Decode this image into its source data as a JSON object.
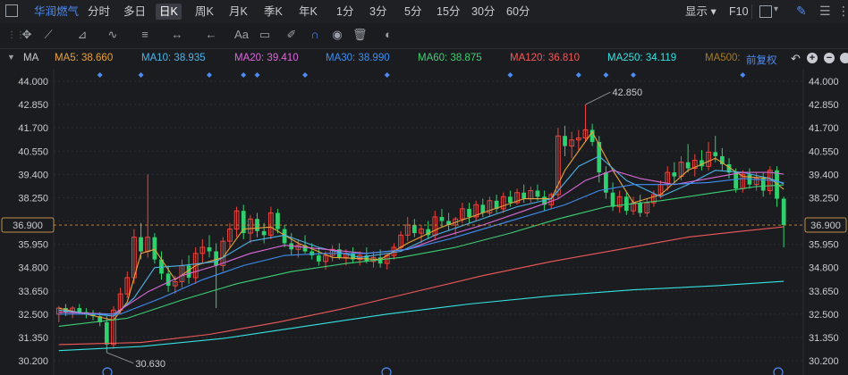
{
  "topbar": {
    "stock_name": "华润燃气",
    "tabs": [
      "分时",
      "多日",
      "日K",
      "周K",
      "月K",
      "季K",
      "年K",
      "1分",
      "3分",
      "5分",
      "15分",
      "30分",
      "60分"
    ],
    "active_tab": "日K",
    "display_label": "显示",
    "f10_label": "F10"
  },
  "ma_row": {
    "title": "MA",
    "items": [
      {
        "label": "MA5: 38.660",
        "color": "#e8a33c"
      },
      {
        "label": "MA10: 38.935",
        "color": "#4fb3e8"
      },
      {
        "label": "MA20: 39.410",
        "color": "#d86ad8"
      },
      {
        "label": "MA30: 38.990",
        "color": "#3f8ef0"
      },
      {
        "label": "MA60: 38.875",
        "color": "#3ccf73"
      },
      {
        "label": "MA120: 36.810",
        "color": "#f05a5a"
      },
      {
        "label": "MA250: 34.119",
        "color": "#35e3e3"
      },
      {
        "label": "MA500: ",
        "color": "#a07c2c"
      }
    ],
    "adjust_label": "前复权"
  },
  "chart_data": {
    "type": "candlestick",
    "y_ticks": [
      "44.000",
      "42.850",
      "41.700",
      "40.550",
      "39.400",
      "38.250",
      "37.100",
      "35.950",
      "34.800",
      "33.650",
      "32.500",
      "31.350",
      "30.200"
    ],
    "ylim": [
      30.2,
      44.0
    ],
    "current_price": "36.900",
    "annotations": {
      "high": "42.850",
      "low": "30.630"
    },
    "colors": {
      "up": "#f0443b",
      "down": "#2fd06e",
      "background": "#1b1c20",
      "grid": "#2a2c31"
    },
    "candles": [
      [
        32.5,
        32.9,
        32.1,
        32.8
      ],
      [
        32.8,
        33.0,
        32.4,
        32.6
      ],
      [
        32.6,
        32.9,
        32.3,
        32.8
      ],
      [
        32.8,
        33.0,
        32.5,
        32.6
      ],
      [
        32.6,
        32.8,
        32.3,
        32.5
      ],
      [
        32.5,
        32.7,
        32.2,
        32.4
      ],
      [
        32.4,
        32.6,
        31.9,
        32.1
      ],
      [
        32.1,
        32.4,
        30.6,
        31.0
      ],
      [
        31.0,
        32.9,
        30.8,
        32.7
      ],
      [
        32.7,
        33.8,
        32.5,
        33.5
      ],
      [
        33.5,
        34.6,
        33.3,
        34.3
      ],
      [
        34.3,
        36.7,
        34.0,
        36.3
      ],
      [
        36.3,
        37.0,
        35.2,
        35.6
      ],
      [
        35.6,
        39.4,
        35.3,
        36.3
      ],
      [
        36.3,
        36.5,
        35.0,
        35.2
      ],
      [
        35.2,
        35.6,
        34.2,
        34.5
      ],
      [
        34.5,
        34.9,
        33.6,
        33.9
      ],
      [
        33.9,
        34.4,
        33.5,
        34.1
      ],
      [
        34.1,
        35.2,
        33.8,
        34.9
      ],
      [
        34.9,
        35.4,
        34.0,
        34.3
      ],
      [
        34.3,
        35.8,
        34.0,
        35.5
      ],
      [
        35.5,
        36.2,
        35.0,
        35.8
      ],
      [
        35.8,
        36.4,
        35.3,
        35.6
      ],
      [
        35.6,
        36.0,
        32.8,
        34.9
      ],
      [
        34.9,
        36.3,
        34.6,
        36.1
      ],
      [
        36.1,
        37.0,
        35.8,
        36.7
      ],
      [
        36.7,
        37.8,
        36.3,
        37.6
      ],
      [
        37.6,
        37.9,
        36.2,
        36.5
      ],
      [
        36.5,
        37.4,
        36.0,
        37.2
      ],
      [
        37.2,
        37.5,
        36.3,
        36.6
      ],
      [
        36.6,
        37.0,
        36.0,
        36.4
      ],
      [
        36.4,
        37.8,
        36.2,
        37.5
      ],
      [
        37.5,
        37.7,
        36.5,
        36.7
      ],
      [
        36.7,
        36.9,
        35.8,
        36.0
      ],
      [
        36.0,
        36.5,
        35.4,
        35.7
      ],
      [
        35.7,
        36.2,
        35.3,
        35.9
      ],
      [
        35.9,
        36.4,
        35.5,
        35.6
      ],
      [
        35.6,
        36.0,
        35.2,
        35.4
      ],
      [
        35.4,
        35.8,
        34.9,
        35.1
      ],
      [
        35.1,
        35.6,
        34.7,
        35.4
      ],
      [
        35.4,
        35.9,
        35.1,
        35.7
      ],
      [
        35.7,
        36.0,
        35.2,
        35.3
      ],
      [
        35.3,
        35.7,
        34.9,
        35.5
      ],
      [
        35.5,
        35.8,
        35.0,
        35.2
      ],
      [
        35.2,
        35.6,
        34.9,
        35.4
      ],
      [
        35.4,
        35.8,
        35.0,
        35.1
      ],
      [
        35.1,
        35.6,
        34.8,
        35.3
      ],
      [
        35.3,
        35.7,
        34.8,
        35.0
      ],
      [
        35.0,
        35.5,
        34.7,
        35.4
      ],
      [
        35.4,
        36.0,
        35.2,
        35.8
      ],
      [
        35.8,
        36.6,
        35.6,
        36.4
      ],
      [
        36.4,
        37.3,
        36.1,
        36.9
      ],
      [
        36.9,
        37.2,
        36.3,
        36.5
      ],
      [
        36.5,
        36.9,
        36.0,
        36.7
      ],
      [
        36.7,
        37.1,
        36.2,
        36.4
      ],
      [
        36.4,
        37.6,
        36.2,
        37.3
      ],
      [
        37.3,
        37.7,
        36.8,
        37.1
      ],
      [
        37.1,
        37.5,
        36.6,
        36.9
      ],
      [
        36.9,
        37.3,
        36.4,
        37.2
      ],
      [
        37.2,
        38.0,
        37.0,
        37.7
      ],
      [
        37.7,
        38.0,
        37.0,
        37.3
      ],
      [
        37.3,
        38.1,
        37.1,
        37.9
      ],
      [
        37.9,
        38.2,
        37.3,
        37.5
      ],
      [
        37.5,
        38.3,
        37.3,
        38.1
      ],
      [
        38.1,
        38.4,
        37.5,
        37.7
      ],
      [
        37.7,
        38.5,
        37.5,
        38.3
      ],
      [
        38.3,
        38.6,
        37.8,
        38.0
      ],
      [
        38.0,
        38.7,
        37.9,
        38.5
      ],
      [
        38.5,
        38.9,
        38.0,
        38.2
      ],
      [
        38.2,
        38.8,
        38.0,
        38.6
      ],
      [
        38.6,
        38.9,
        38.1,
        38.3
      ],
      [
        38.3,
        38.6,
        37.6,
        37.9
      ],
      [
        37.9,
        38.5,
        37.7,
        38.4
      ],
      [
        38.4,
        41.7,
        38.2,
        41.3
      ],
      [
        41.3,
        41.8,
        40.3,
        40.8
      ],
      [
        40.8,
        41.5,
        40.2,
        41.1
      ],
      [
        41.1,
        41.6,
        40.6,
        41.2
      ],
      [
        41.2,
        42.85,
        41.0,
        41.6
      ],
      [
        41.6,
        41.9,
        40.8,
        41.0
      ],
      [
        41.0,
        41.3,
        39.0,
        39.5
      ],
      [
        39.5,
        39.8,
        38.2,
        38.5
      ],
      [
        38.5,
        39.0,
        37.6,
        37.8
      ],
      [
        37.8,
        38.6,
        37.5,
        38.3
      ],
      [
        38.3,
        38.5,
        37.4,
        37.6
      ],
      [
        37.6,
        38.3,
        37.4,
        38.0
      ],
      [
        38.0,
        38.4,
        37.3,
        37.5
      ],
      [
        37.5,
        38.2,
        37.3,
        38.0
      ],
      [
        38.0,
        38.6,
        37.8,
        38.4
      ],
      [
        38.4,
        39.1,
        38.2,
        38.9
      ],
      [
        38.9,
        39.8,
        38.6,
        39.5
      ],
      [
        39.5,
        40.0,
        39.0,
        39.3
      ],
      [
        39.3,
        40.3,
        39.1,
        40.0
      ],
      [
        40.0,
        40.9,
        39.5,
        39.7
      ],
      [
        39.7,
        40.4,
        39.3,
        40.1
      ],
      [
        40.1,
        40.6,
        39.6,
        39.8
      ],
      [
        39.8,
        41.0,
        39.6,
        40.5
      ],
      [
        40.5,
        41.3,
        40.0,
        40.3
      ],
      [
        40.3,
        40.7,
        39.6,
        39.9
      ],
      [
        39.9,
        40.2,
        39.2,
        39.5
      ],
      [
        39.5,
        39.7,
        38.5,
        38.7
      ],
      [
        38.7,
        39.6,
        38.5,
        39.4
      ],
      [
        39.4,
        39.7,
        38.7,
        38.9
      ],
      [
        38.9,
        39.5,
        38.6,
        39.2
      ],
      [
        39.2,
        39.5,
        38.3,
        38.6
      ],
      [
        38.6,
        39.8,
        38.4,
        39.6
      ],
      [
        39.6,
        39.8,
        37.8,
        38.2
      ],
      [
        38.2,
        38.3,
        35.8,
        36.9
      ]
    ],
    "moving_averages": {
      "MA5": [
        [
          0,
          32.8
        ],
        [
          8,
          32.2
        ],
        [
          10,
          33.1
        ],
        [
          12,
          35.5
        ],
        [
          14,
          35.7
        ],
        [
          17,
          34.2
        ],
        [
          20,
          34.9
        ],
        [
          24,
          35.3
        ],
        [
          27,
          36.7
        ],
        [
          31,
          36.8
        ],
        [
          35,
          36.0
        ],
        [
          40,
          35.3
        ],
        [
          47,
          35.2
        ],
        [
          51,
          36.0
        ],
        [
          56,
          36.8
        ],
        [
          62,
          37.5
        ],
        [
          68,
          38.2
        ],
        [
          72,
          38.2
        ],
        [
          74,
          39.6
        ],
        [
          78,
          41.5
        ],
        [
          81,
          39.6
        ],
        [
          84,
          38.0
        ],
        [
          88,
          38.4
        ],
        [
          92,
          39.6
        ],
        [
          96,
          40.2
        ],
        [
          100,
          39.3
        ],
        [
          104,
          39.2
        ],
        [
          106,
          38.66
        ]
      ],
      "MA10": [
        [
          0,
          32.7
        ],
        [
          8,
          32.4
        ],
        [
          11,
          33.3
        ],
        [
          14,
          34.8
        ],
        [
          18,
          34.9
        ],
        [
          23,
          35.1
        ],
        [
          28,
          36.1
        ],
        [
          33,
          36.4
        ],
        [
          38,
          35.8
        ],
        [
          44,
          35.3
        ],
        [
          50,
          35.6
        ],
        [
          55,
          36.4
        ],
        [
          61,
          37.1
        ],
        [
          67,
          37.8
        ],
        [
          72,
          38.2
        ],
        [
          76,
          39.8
        ],
        [
          79,
          40.3
        ],
        [
          83,
          39.1
        ],
        [
          88,
          38.3
        ],
        [
          92,
          38.9
        ],
        [
          96,
          39.6
        ],
        [
          100,
          39.5
        ],
        [
          104,
          39.2
        ],
        [
          106,
          38.94
        ]
      ],
      "MA20": [
        [
          0,
          32.6
        ],
        [
          8,
          32.5
        ],
        [
          13,
          33.6
        ],
        [
          18,
          34.4
        ],
        [
          23,
          34.9
        ],
        [
          28,
          35.5
        ],
        [
          33,
          35.9
        ],
        [
          39,
          35.7
        ],
        [
          45,
          35.5
        ],
        [
          51,
          35.7
        ],
        [
          56,
          36.3
        ],
        [
          62,
          36.9
        ],
        [
          68,
          37.6
        ],
        [
          73,
          38.2
        ],
        [
          77,
          39.1
        ],
        [
          81,
          39.6
        ],
        [
          85,
          39.2
        ],
        [
          90,
          38.9
        ],
        [
          95,
          39.2
        ],
        [
          100,
          39.5
        ],
        [
          104,
          39.5
        ],
        [
          106,
          39.41
        ]
      ],
      "MA30": [
        [
          0,
          32.5
        ],
        [
          9,
          32.5
        ],
        [
          15,
          33.3
        ],
        [
          21,
          34.2
        ],
        [
          27,
          34.9
        ],
        [
          33,
          35.4
        ],
        [
          39,
          35.5
        ],
        [
          45,
          35.5
        ],
        [
          51,
          35.7
        ],
        [
          57,
          36.2
        ],
        [
          63,
          36.8
        ],
        [
          69,
          37.4
        ],
        [
          74,
          37.9
        ],
        [
          79,
          38.6
        ],
        [
          84,
          38.9
        ],
        [
          89,
          38.9
        ],
        [
          95,
          39.0
        ],
        [
          100,
          39.2
        ],
        [
          104,
          39.1
        ],
        [
          106,
          38.99
        ]
      ],
      "MA60": [
        [
          0,
          31.9
        ],
        [
          10,
          32.3
        ],
        [
          18,
          33.2
        ],
        [
          26,
          34.0
        ],
        [
          34,
          34.6
        ],
        [
          42,
          35.0
        ],
        [
          50,
          35.3
        ],
        [
          58,
          35.8
        ],
        [
          66,
          36.5
        ],
        [
          73,
          37.2
        ],
        [
          80,
          37.8
        ],
        [
          88,
          38.1
        ],
        [
          96,
          38.5
        ],
        [
          102,
          38.8
        ],
        [
          106,
          38.88
        ]
      ],
      "MA120": [
        [
          0,
          31.0
        ],
        [
          12,
          31.1
        ],
        [
          22,
          31.5
        ],
        [
          32,
          32.1
        ],
        [
          42,
          32.8
        ],
        [
          52,
          33.6
        ],
        [
          62,
          34.4
        ],
        [
          72,
          35.1
        ],
        [
          82,
          35.7
        ],
        [
          92,
          36.3
        ],
        [
          100,
          36.6
        ],
        [
          106,
          36.81
        ]
      ],
      "MA250": [
        [
          0,
          30.7
        ],
        [
          12,
          30.9
        ],
        [
          24,
          31.3
        ],
        [
          36,
          31.9
        ],
        [
          48,
          32.5
        ],
        [
          60,
          33.0
        ],
        [
          72,
          33.4
        ],
        [
          84,
          33.7
        ],
        [
          96,
          33.9
        ],
        [
          106,
          34.12
        ]
      ]
    }
  }
}
